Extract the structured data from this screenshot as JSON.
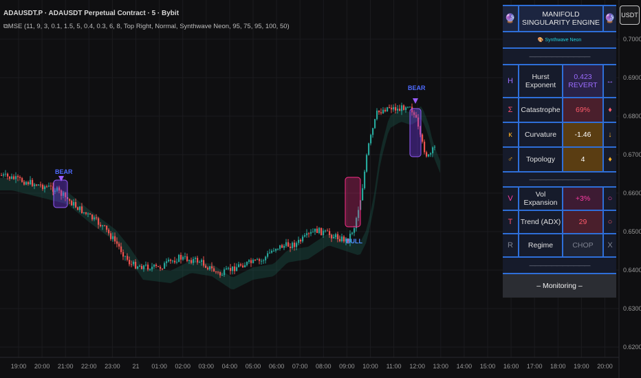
{
  "header": {
    "line1": "ADAUSDT.P · ADAUSDT Perpetual Contract · 5 · Bybit",
    "line2": "⧉MSE (11, 9, 3, 0.1, 1.5, 5, 0.4, 0.3, 6, 8, Top Right, Normal, Synthwave Neon, 95, 75, 95, 100, 50)"
  },
  "currency_badge": "USDT",
  "price_axis": [
    "0.7000",
    "0.6900",
    "0.6800",
    "0.6700",
    "0.6600",
    "0.6500",
    "0.6400",
    "0.6300",
    "0.6200"
  ],
  "time_axis": [
    "19:00",
    "20:00",
    "21:00",
    "22:00",
    "23:00",
    "21",
    "01:00",
    "02:00",
    "03:00",
    "04:00",
    "05:00",
    "06:00",
    "07:00",
    "08:00",
    "09:00",
    "10:00",
    "11:00",
    "12:00",
    "13:00",
    "14:00",
    "15:00",
    "16:00",
    "17:00",
    "18:00",
    "19:00",
    "20:00"
  ],
  "signals": [
    {
      "label": "BEAR",
      "color": "#4e6bff"
    },
    {
      "label": "BEAR",
      "color": "#4e6bff"
    },
    {
      "label": "BULL",
      "color": "#4e8dff"
    }
  ],
  "dashboard": {
    "title": "MANIFOLD SINGULARITY ENGINE",
    "theme": "🎨 Synthwave Neon",
    "divider": "———————————",
    "rows": [
      {
        "icon": "H",
        "name": "Hurst Exponent",
        "value": "0.423",
        "value2": "REVERT",
        "status": "↔",
        "icon_color": "#9c6cff",
        "value_color": "#9c6cff",
        "bg": "#2a2248",
        "status_color": "#9c6cff"
      },
      {
        "icon": "Σ",
        "name": "Catastrophe",
        "value": "69%",
        "value2": "",
        "status": "♦",
        "icon_color": "#ff4d6d",
        "value_color": "#ff5a6a",
        "bg": "#4a1f2c",
        "status_color": "#ff5a6a"
      },
      {
        "icon": "κ",
        "name": "Curvature",
        "value": "-1.46",
        "value2": "",
        "status": "↓",
        "icon_color": "#ffb020",
        "value_color": "#ffffff",
        "bg": "#5a3d12",
        "status_color": "#ffb020"
      },
      {
        "icon": "♂",
        "name": "Topology",
        "value": "4",
        "value2": "",
        "status": "♦",
        "icon_color": "#ffb020",
        "value_color": "#ffffff",
        "bg": "#5a3d12",
        "status_color": "#ffb020"
      }
    ],
    "rows2": [
      {
        "icon": "V",
        "name": "Vol Expansion",
        "value": "+3%",
        "status": "○",
        "icon_color": "#ff3da6",
        "value_color": "#ff3da6",
        "bg": "#3d1b33",
        "status_color": "#ff3da6"
      },
      {
        "icon": "T",
        "name": "Trend (ADX)",
        "value": "29",
        "status": "○",
        "icon_color": "#ff4d6d",
        "value_color": "#ff5a6a",
        "bg": "#4a1f2c",
        "status_color": "#ff5a6a"
      },
      {
        "icon": "R",
        "name": "Regime",
        "value": "CHOP",
        "status": "X",
        "icon_color": "#7f8391",
        "value_color": "#7f8391",
        "bg": "#1f2434",
        "status_color": "#7f8391"
      }
    ],
    "footer": "– Monitoring –"
  },
  "colors": {
    "bull": "#26a69a",
    "bear": "#ef5350",
    "band": "#1e5e4f",
    "accent": "#2e6fd9"
  }
}
